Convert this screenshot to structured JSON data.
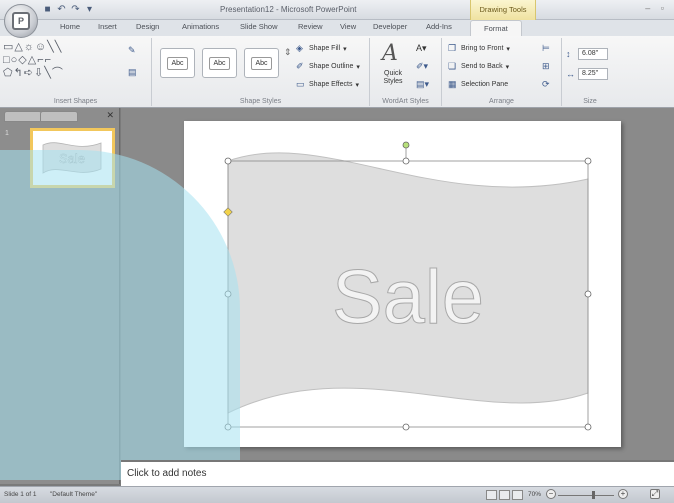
{
  "app": {
    "window_title": "Presentation12 - Microsoft PowerPoint",
    "context_tab": "Drawing Tools"
  },
  "tabs": [
    {
      "label": "Home"
    },
    {
      "label": "Insert"
    },
    {
      "label": "Design"
    },
    {
      "label": "Animations"
    },
    {
      "label": "Slide Show"
    },
    {
      "label": "Review"
    },
    {
      "label": "View"
    },
    {
      "label": "Developer"
    },
    {
      "label": "Add-Ins"
    },
    {
      "label": "Format",
      "active": true
    }
  ],
  "ribbon": {
    "groups": {
      "insert_shapes": "Insert Shapes",
      "shape_styles": "Shape Styles",
      "wordart_styles": "WordArt Styles",
      "arrange": "Arrange",
      "size": "Size"
    },
    "style_samples": [
      "Abc",
      "Abc",
      "Abc"
    ],
    "shape_fill": "Shape Fill",
    "shape_outline": "Shape Outline",
    "shape_effects": "Shape Effects",
    "quick_styles": "Quick Styles",
    "bring_to_front": "Bring to Front",
    "send_to_back": "Send to Back",
    "selection_pane": "Selection Pane",
    "height": "6.08\"",
    "width": "8.25\""
  },
  "slide": {
    "text": "Sale",
    "thumb_text": "Sale",
    "number": "1"
  },
  "notes": {
    "placeholder": "Click to add notes"
  },
  "status": {
    "slide_info": "Slide 1 of 1",
    "theme": "\"Default Theme\"",
    "zoom": "70%"
  },
  "colors": {
    "banner_fill": "#dedede",
    "thumb_border": "#f2c75c",
    "context_tab": "#efe2a0"
  }
}
